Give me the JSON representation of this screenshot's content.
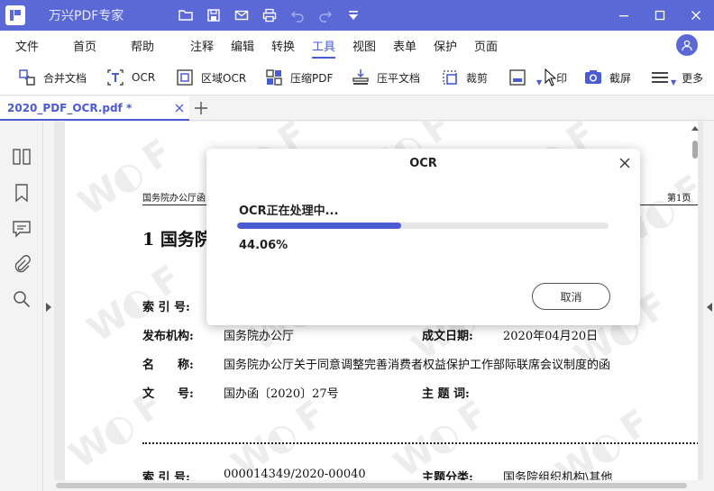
{
  "app": {
    "title": "万兴PDF专家"
  },
  "menu": {
    "items": [
      "文件",
      "首页",
      "帮助",
      "注释",
      "编辑",
      "转换",
      "工具",
      "视图",
      "表单",
      "保护",
      "页面"
    ],
    "active_index": 6
  },
  "toolbar": {
    "items": [
      {
        "label": "合并文档",
        "icon": "merge-icon"
      },
      {
        "label": "OCR",
        "icon": "ocr-icon"
      },
      {
        "label": "区域OCR",
        "icon": "area-ocr-icon"
      },
      {
        "label": "压缩PDF",
        "icon": "compress-icon"
      },
      {
        "label": "压平文档",
        "icon": "flatten-icon"
      },
      {
        "label": "裁剪",
        "icon": "crop-icon"
      },
      {
        "label": "水印",
        "icon": "watermark-icon"
      },
      {
        "label": "截屏",
        "icon": "screenshot-icon"
      },
      {
        "label": "更多",
        "icon": "more-icon"
      }
    ],
    "watermark_visible": "印",
    "more_visible": "更多"
  },
  "tabs": {
    "active_label": "2020_PDF_OCR.pdf *"
  },
  "document": {
    "header_left": "国务院办公厅函",
    "header_right": "第1页",
    "heading": "1 国务院",
    "rows": {
      "suoyin_label": "索 引 号:",
      "fabu_label": "发布机构:",
      "fabu_value": "国务院办公厅",
      "chengwen_label": "成文日期:",
      "chengwen_value": "2020年04月20日",
      "mingcheng_label": "名　　称:",
      "mingcheng_value": "国务院办公厅关于同意调整完善消费者权益保护工作部际联席会议制度的函",
      "wenhao_label": "文　　号:",
      "wenhao_value": "国办函〔2020〕27号",
      "zhuti_label": "主 题 词:",
      "suoyin2_label": "索 引 号:",
      "suoyin2_value": "000014349/2020-00040",
      "zhuti2_label": "主题分类:",
      "zhuti2_value": "国务院组织机构\\其他"
    }
  },
  "dialog": {
    "title": "OCR",
    "status": "OCR正在处理中...",
    "progress": 0.4406,
    "percent_label": "44.06%",
    "cancel_label": "取消"
  },
  "colors": {
    "titlebar": "#5b69d6",
    "accent": "#4a5bd4"
  }
}
